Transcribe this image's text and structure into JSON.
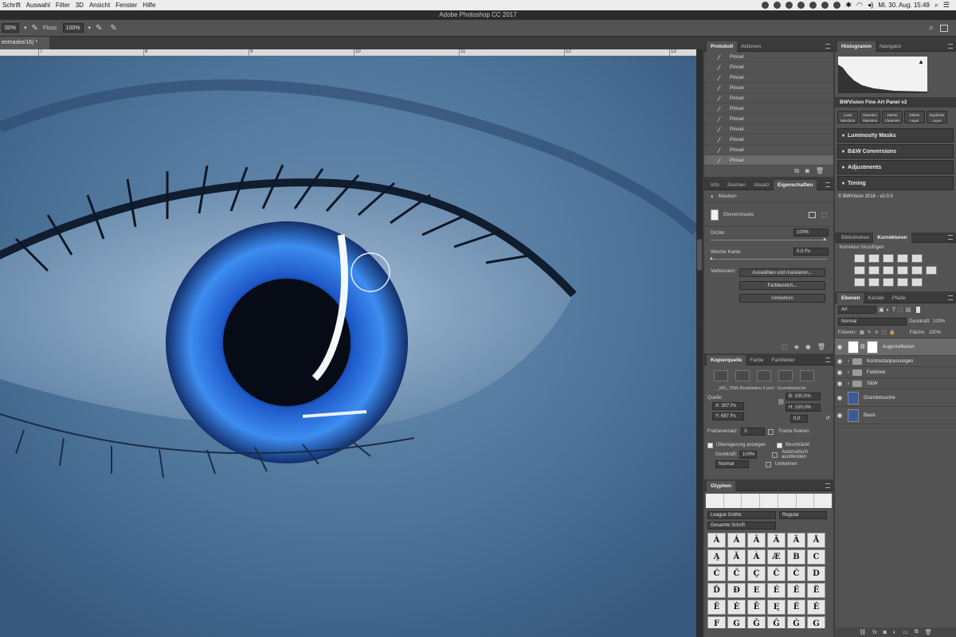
{
  "menubar": {
    "items": [
      "Schrift",
      "Auswahl",
      "Filter",
      "3D",
      "Ansicht",
      "Fenster",
      "Hilfe"
    ],
    "clock": "Mi. 30. Aug.  15:49"
  },
  "title": "Adobe Photoshop CC 2017",
  "options": {
    "opacity_value": "00%",
    "flow_label": "Fluss:",
    "flow_value": "100%"
  },
  "document": {
    "tab_label": "enmaske/16) *"
  },
  "ruler": {
    "ticks": [
      "7",
      "8",
      "9",
      "10",
      "11",
      "12",
      "13"
    ]
  },
  "protokoll": {
    "tabs": [
      "Protokoll",
      "Aktionen"
    ],
    "items": [
      "Pinsel",
      "Pinsel",
      "Pinsel",
      "Pinsel",
      "Pinsel",
      "Pinsel",
      "Pinsel",
      "Pinsel",
      "Pinsel",
      "Pinsel",
      "Pinsel"
    ]
  },
  "properties": {
    "tabs": [
      "Info",
      "Zeichen",
      "Absatz",
      "Eigenschaften"
    ],
    "masks_label": "Masken",
    "layermask_label": "Ebenenmaske",
    "density_label": "Dichte:",
    "density_value": "100%",
    "feather_label": "Weiche Kante:",
    "feather_value": "0,0 Px",
    "improve_label": "Verbessern:",
    "btn_select_mask": "Auswählen und maskieren...",
    "btn_color_range": "Farbbereich...",
    "btn_invert": "Umkehren"
  },
  "histogram": {
    "tabs": [
      "Histogramm",
      "Navigator"
    ]
  },
  "bwvision": {
    "title": "BWVision Fine Art Panel v2",
    "buttons": [
      "Load Selection",
      "Deselect Selection",
      "Delete Channels",
      "Delete Layer",
      "Duplicate Layer"
    ],
    "sections": [
      "Luminosity Masks",
      "B&W Conversions",
      "Adjustments",
      "Toning"
    ],
    "copyright": "© BWVision 2016 - v2.0.0"
  },
  "korrekturen": {
    "tabs": [
      "Bibliotheken",
      "Korrekturen"
    ],
    "add_label": "Korrektur hinzufügen"
  },
  "layers": {
    "tabs": [
      "Ebenen",
      "Kanäle",
      "Pfade"
    ],
    "filter_value": "Art",
    "blend_mode": "Normal",
    "opacity_label": "Deckkraft:",
    "opacity_value": "100%",
    "lock_label": "Fixieren:",
    "fill_label": "Fläche:",
    "fill_value": "100%",
    "items": [
      {
        "name": "Augenreflexion",
        "kind": "mask"
      },
      {
        "name": "Kontrastanpassungen",
        "kind": "folder"
      },
      {
        "name": "Farblook",
        "kind": "folder"
      },
      {
        "name": "S&W",
        "kind": "folder"
      },
      {
        "name": "Grundretusche",
        "kind": "image"
      },
      {
        "name": "Basis",
        "kind": "image"
      }
    ]
  },
  "kopierquelle": {
    "tabs": [
      "Kopierquelle",
      "Farbe",
      "Farbfelder"
    ],
    "file": "_MG_7895-Bearbeiten-2.psd : Grundretusche",
    "source_label": "Quelle:",
    "x_value": "X: 307 Px",
    "y_value": "Y: 687 Px",
    "w_value": "B: 100,0%",
    "h_value": "H: 100,0%",
    "angle_value": "0,0",
    "frame_offset_label": "Frameversatz:",
    "frame_offset_value": "0",
    "frame_fix_label": "Frame fixieren",
    "show_overlay_label": "Überlagerung anzeigen",
    "clipped_label": "Beschränkt",
    "opacity_label": "Deckkraft:",
    "opacity_value": "100%",
    "auto_hide_label": "Automatisch ausblenden",
    "mode_value": "Normal",
    "invert_label": "Umkehren"
  },
  "glyphs": {
    "title": "Glyphen",
    "font": "League Gothic",
    "style": "Regular",
    "set": "Gesamte Schrift",
    "chars": [
      "À",
      "Á",
      "Â",
      "Ã",
      "Ä",
      "Å",
      "Ą",
      "Ă",
      "À",
      "Æ",
      "B",
      "C",
      "Ć",
      "Č",
      "Ç",
      "Ĉ",
      "Ċ",
      "D",
      "Ď",
      "Đ",
      "E",
      "É",
      "Ê",
      "Ë",
      "Ě",
      "Ė",
      "Ē",
      "Ę",
      "Ĕ",
      "Ė",
      "F",
      "G",
      "Ğ",
      "Ĝ",
      "Ġ",
      "G",
      "Ħ",
      "Ĥ",
      "H",
      "I"
    ]
  },
  "colors": {
    "accent": "#2a7cff",
    "panel": "#535353",
    "eye_iris": "#1f5dd6"
  }
}
